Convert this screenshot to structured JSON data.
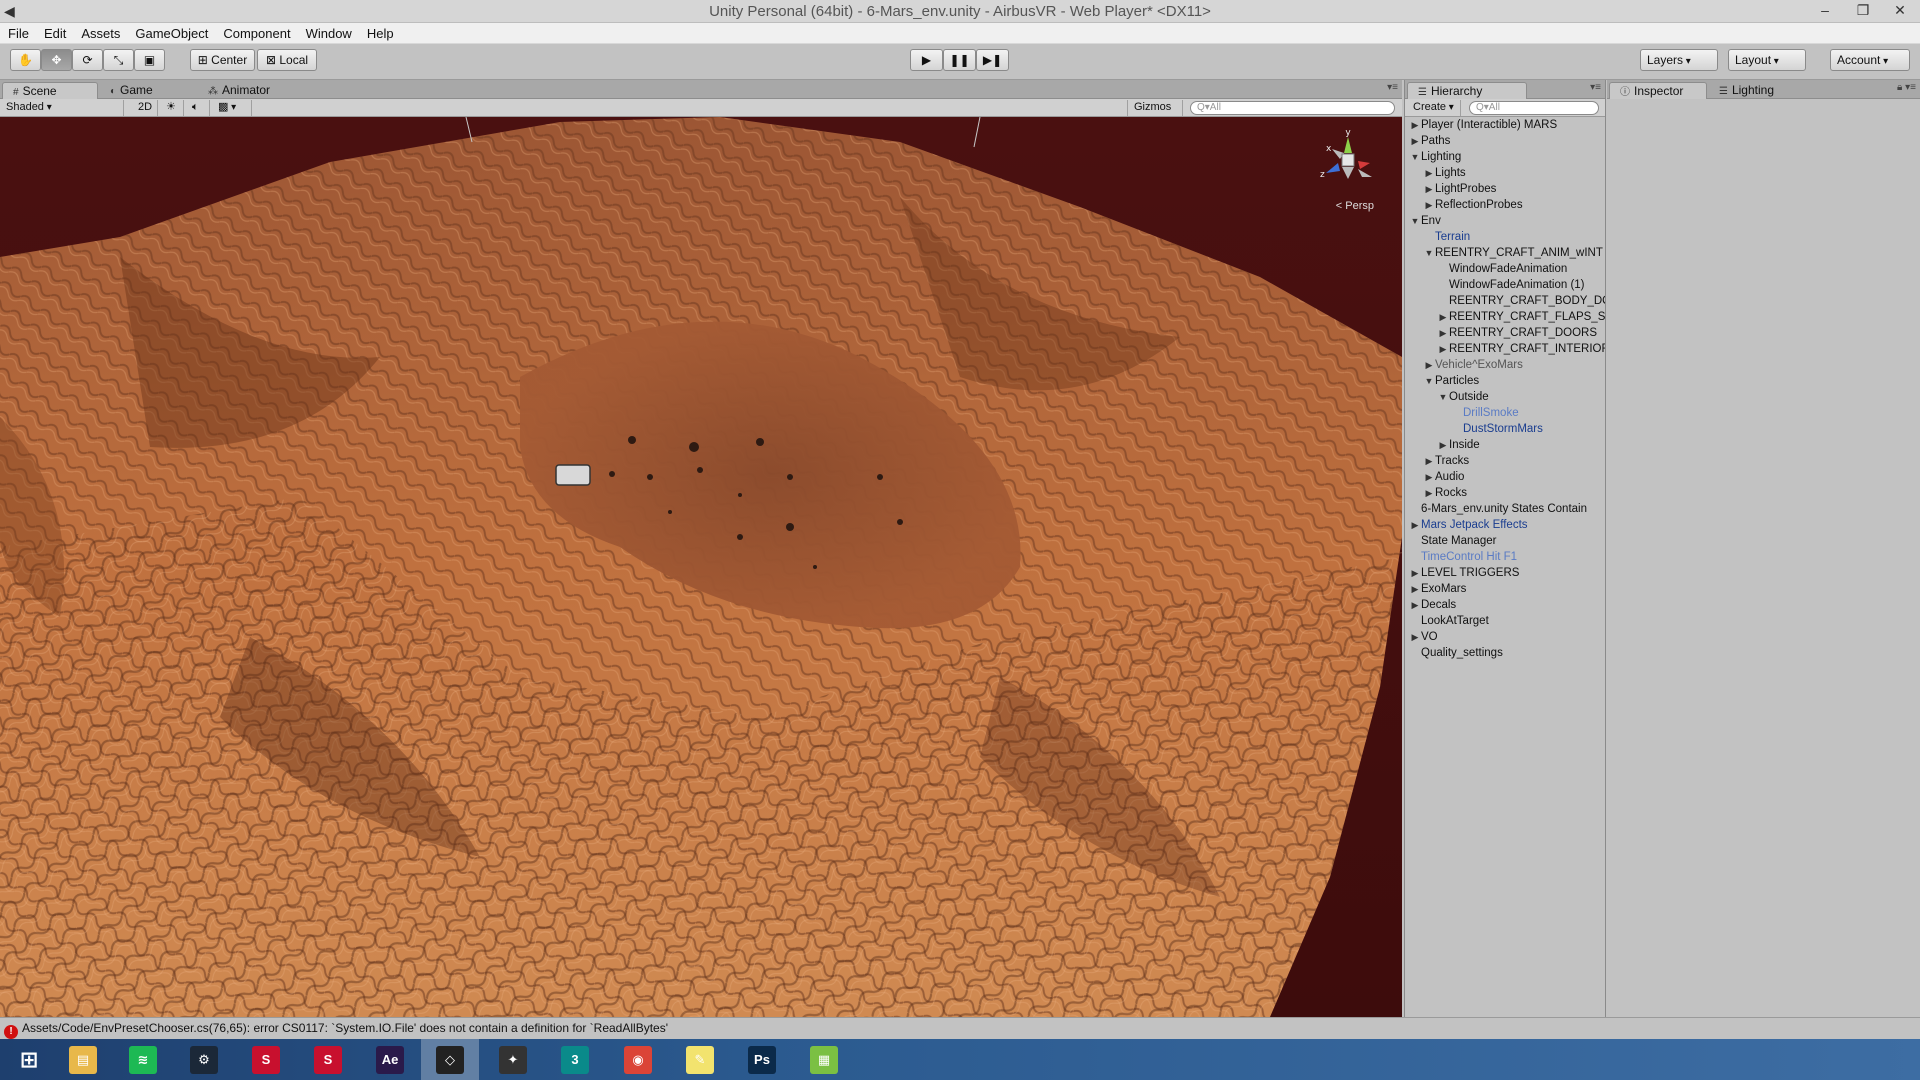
{
  "window": {
    "title": "Unity Personal (64bit) - 6-Mars_env.unity - AirbusVR - Web Player* <DX11>",
    "min_symbol": "–",
    "max_symbol": "❐",
    "close_symbol": "✕"
  },
  "menu": [
    "File",
    "Edit",
    "Assets",
    "GameObject",
    "Component",
    "Window",
    "Help"
  ],
  "toolbar": {
    "pivot_label": "Center",
    "space_label": "Local",
    "layers_label": "Layers",
    "layout_label": "Layout",
    "account_label": "Account"
  },
  "scene_tabs": [
    {
      "label": "Scene",
      "icon": "#"
    },
    {
      "label": "Game",
      "icon": "◐"
    },
    {
      "label": "Animator",
      "icon": "⁂"
    }
  ],
  "scene_toolbar": {
    "shading_mode": "Shaded",
    "mode_2d": "2D",
    "gizmos_label": "Gizmos",
    "search_placeholder": "Q▾All"
  },
  "viewport": {
    "persp_label": "Persp",
    "axis_y": "y",
    "axis_x": "x",
    "axis_z": "z",
    "sky_color": "#3d0c0c",
    "terrain_color": "#b8673a"
  },
  "hierarchy": {
    "tab_label": "Hierarchy",
    "create_label": "Create",
    "search_placeholder": "Q▾All",
    "items": [
      {
        "label": "Player (Interactible) MARS",
        "depth": 0,
        "arrow": "▶",
        "style": "normal"
      },
      {
        "label": "Paths",
        "depth": 0,
        "arrow": "▶",
        "style": "normal"
      },
      {
        "label": "Lighting",
        "depth": 0,
        "arrow": "▼",
        "style": "normal"
      },
      {
        "label": "Lights",
        "depth": 1,
        "arrow": "▶",
        "style": "normal"
      },
      {
        "label": "LightProbes",
        "depth": 1,
        "arrow": "▶",
        "style": "normal"
      },
      {
        "label": "ReflectionProbes",
        "depth": 1,
        "arrow": "▶",
        "style": "normal"
      },
      {
        "label": "Env",
        "depth": 0,
        "arrow": "▼",
        "style": "normal"
      },
      {
        "label": "Terrain",
        "depth": 1,
        "arrow": "",
        "style": "prefab"
      },
      {
        "label": "REENTRY_CRAFT_ANIM_wINT",
        "depth": 1,
        "arrow": "▼",
        "style": "normal"
      },
      {
        "label": "WindowFadeAnimation",
        "depth": 2,
        "arrow": "",
        "style": "normal"
      },
      {
        "label": "WindowFadeAnimation (1)",
        "depth": 2,
        "arrow": "",
        "style": "normal"
      },
      {
        "label": "REENTRY_CRAFT_BODY_DO",
        "depth": 2,
        "arrow": "",
        "style": "normal"
      },
      {
        "label": "REENTRY_CRAFT_FLAPS_SI",
        "depth": 2,
        "arrow": "▶",
        "style": "normal"
      },
      {
        "label": "REENTRY_CRAFT_DOORS",
        "depth": 2,
        "arrow": "▶",
        "style": "normal"
      },
      {
        "label": "REENTRY_CRAFT_INTERIOR",
        "depth": 2,
        "arrow": "▶",
        "style": "normal"
      },
      {
        "label": "Vehicle^ExoMars",
        "depth": 1,
        "arrow": "▶",
        "style": "inactive"
      },
      {
        "label": "Particles",
        "depth": 1,
        "arrow": "▼",
        "style": "normal"
      },
      {
        "label": "Outside",
        "depth": 2,
        "arrow": "▼",
        "style": "normal"
      },
      {
        "label": "DrillSmoke",
        "depth": 3,
        "arrow": "",
        "style": "prefab-inactive"
      },
      {
        "label": "DustStormMars",
        "depth": 3,
        "arrow": "",
        "style": "prefab"
      },
      {
        "label": "Inside",
        "depth": 2,
        "arrow": "▶",
        "style": "normal"
      },
      {
        "label": "Tracks",
        "depth": 1,
        "arrow": "▶",
        "style": "normal"
      },
      {
        "label": "Audio",
        "depth": 1,
        "arrow": "▶",
        "style": "normal"
      },
      {
        "label": "Rocks",
        "depth": 1,
        "arrow": "▶",
        "style": "normal"
      },
      {
        "label": "6-Mars_env.unity States Contain",
        "depth": 0,
        "arrow": "",
        "style": "normal"
      },
      {
        "label": "Mars Jetpack Effects",
        "depth": 0,
        "arrow": "▶",
        "style": "prefab"
      },
      {
        "label": "State Manager",
        "depth": 0,
        "arrow": "",
        "style": "normal"
      },
      {
        "label": "TimeControl Hit F1",
        "depth": 0,
        "arrow": "",
        "style": "prefab-inactive"
      },
      {
        "label": "LEVEL TRIGGERS",
        "depth": 0,
        "arrow": "▶",
        "style": "normal"
      },
      {
        "label": "ExoMars",
        "depth": 0,
        "arrow": "▶",
        "style": "normal"
      },
      {
        "label": "Decals",
        "depth": 0,
        "arrow": "▶",
        "style": "normal"
      },
      {
        "label": "LookAtTarget",
        "depth": 0,
        "arrow": "",
        "style": "normal"
      },
      {
        "label": "VO",
        "depth": 0,
        "arrow": "▶",
        "style": "normal"
      },
      {
        "label": "Quality_settings",
        "depth": 0,
        "arrow": "",
        "style": "normal"
      }
    ]
  },
  "inspector": {
    "tabs": [
      {
        "label": "Inspector",
        "icon": "ⓘ"
      },
      {
        "label": "Lighting",
        "icon": "☰"
      }
    ]
  },
  "status": {
    "message": "Assets/Code/EnvPresetChooser.cs(76,65): error CS0117: `System.IO.File' does not contain a definition for `ReadAllBytes'"
  },
  "taskbar": {
    "apps": [
      {
        "name": "start-icon",
        "glyph": "⊞",
        "color": "transparent"
      },
      {
        "name": "file-explorer-icon",
        "glyph": "▤",
        "color": "#e8b84a"
      },
      {
        "name": "spotify-icon",
        "glyph": "≋",
        "color": "#1db954"
      },
      {
        "name": "steam-icon",
        "glyph": "⚙",
        "color": "#1b2838"
      },
      {
        "name": "sketchup-icon",
        "glyph": "S",
        "color": "#c8102e"
      },
      {
        "name": "sketchup-icon-2",
        "glyph": "S",
        "color": "#c8102e"
      },
      {
        "name": "after-effects-icon",
        "glyph": "Ae",
        "color": "#2a1a4a"
      },
      {
        "name": "unity-icon",
        "glyph": "◇",
        "color": "#222"
      },
      {
        "name": "motionbuilder-icon",
        "glyph": "✦",
        "color": "#333"
      },
      {
        "name": "3dsmax-icon",
        "glyph": "3",
        "color": "#0a8a8a"
      },
      {
        "name": "chrome-icon",
        "glyph": "◉",
        "color": "#db4437"
      },
      {
        "name": "notes-icon",
        "glyph": "✎",
        "color": "#f2e36e"
      },
      {
        "name": "photoshop-icon",
        "glyph": "Ps",
        "color": "#0b2a4a"
      },
      {
        "name": "chart-app-icon",
        "glyph": "▦",
        "color": "#7bc043"
      }
    ]
  }
}
